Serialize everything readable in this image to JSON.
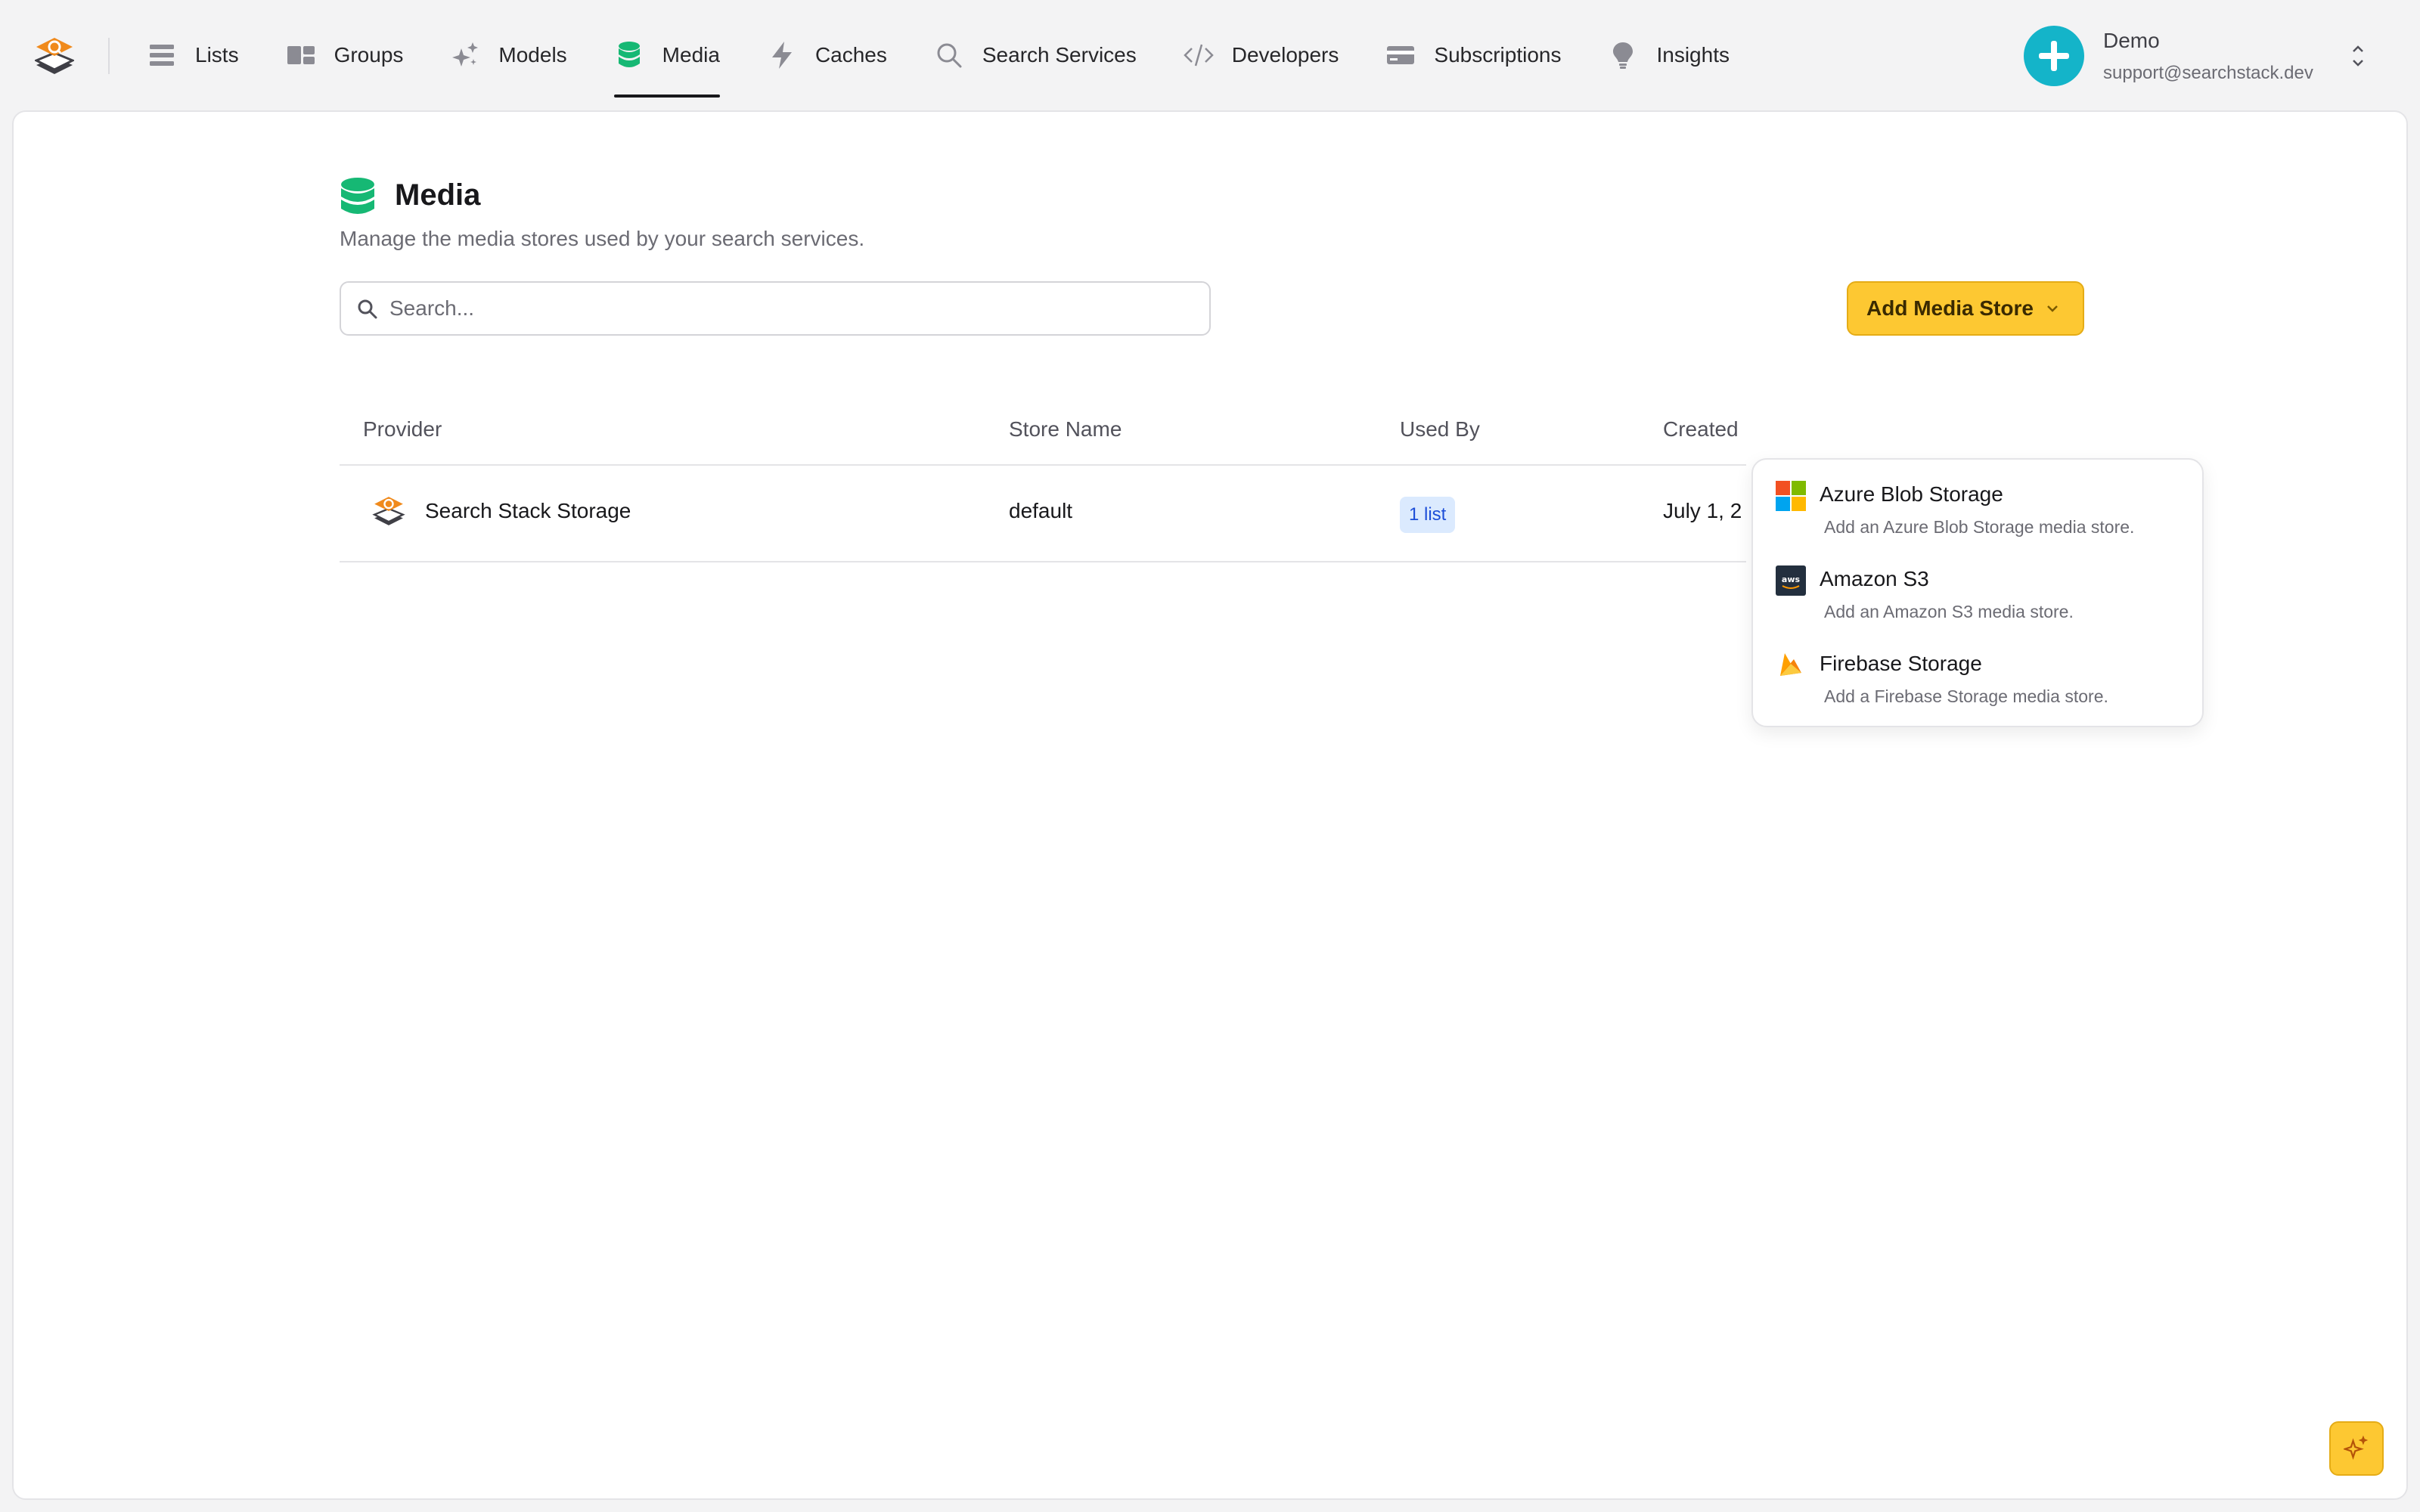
{
  "nav": {
    "items": [
      {
        "label": "Lists",
        "icon": "list-icon"
      },
      {
        "label": "Groups",
        "icon": "groups-icon"
      },
      {
        "label": "Models",
        "icon": "sparkles-icon"
      },
      {
        "label": "Media",
        "icon": "database-icon",
        "active": true
      },
      {
        "label": "Caches",
        "icon": "bolt-icon"
      },
      {
        "label": "Search Services",
        "icon": "search-icon"
      },
      {
        "label": "Developers",
        "icon": "code-icon"
      },
      {
        "label": "Subscriptions",
        "icon": "credit-card-icon"
      },
      {
        "label": "Insights",
        "icon": "lightbulb-icon"
      }
    ]
  },
  "account": {
    "name": "Demo",
    "email": "support@searchstack.dev"
  },
  "page": {
    "title": "Media",
    "subtitle": "Manage the media stores used by your search services."
  },
  "search": {
    "placeholder": "Search...",
    "value": ""
  },
  "add_button": {
    "label": "Add Media Store"
  },
  "table": {
    "headers": {
      "provider": "Provider",
      "store_name": "Store Name",
      "used_by": "Used By",
      "created": "Created"
    },
    "rows": [
      {
        "provider": "Search Stack Storage",
        "store_name": "default",
        "used_by": "1 list",
        "created": "July 1, 2"
      }
    ]
  },
  "dropdown": {
    "items": [
      {
        "title": "Azure Blob Storage",
        "description": "Add an Azure Blob Storage media store.",
        "icon": "microsoft-icon"
      },
      {
        "title": "Amazon S3",
        "description": "Add an Amazon S3 media store.",
        "icon": "aws-icon"
      },
      {
        "title": "Firebase Storage",
        "description": "Add a Firebase Storage media store.",
        "icon": "firebase-icon"
      }
    ]
  },
  "colors": {
    "accent_yellow": "#fdc832",
    "media_green": "#16b874",
    "brand_orange": "#f08a1c",
    "avatar_teal": "#14b4c9",
    "badge_bg": "#dbeafe",
    "badge_text": "#1d4ed8"
  }
}
